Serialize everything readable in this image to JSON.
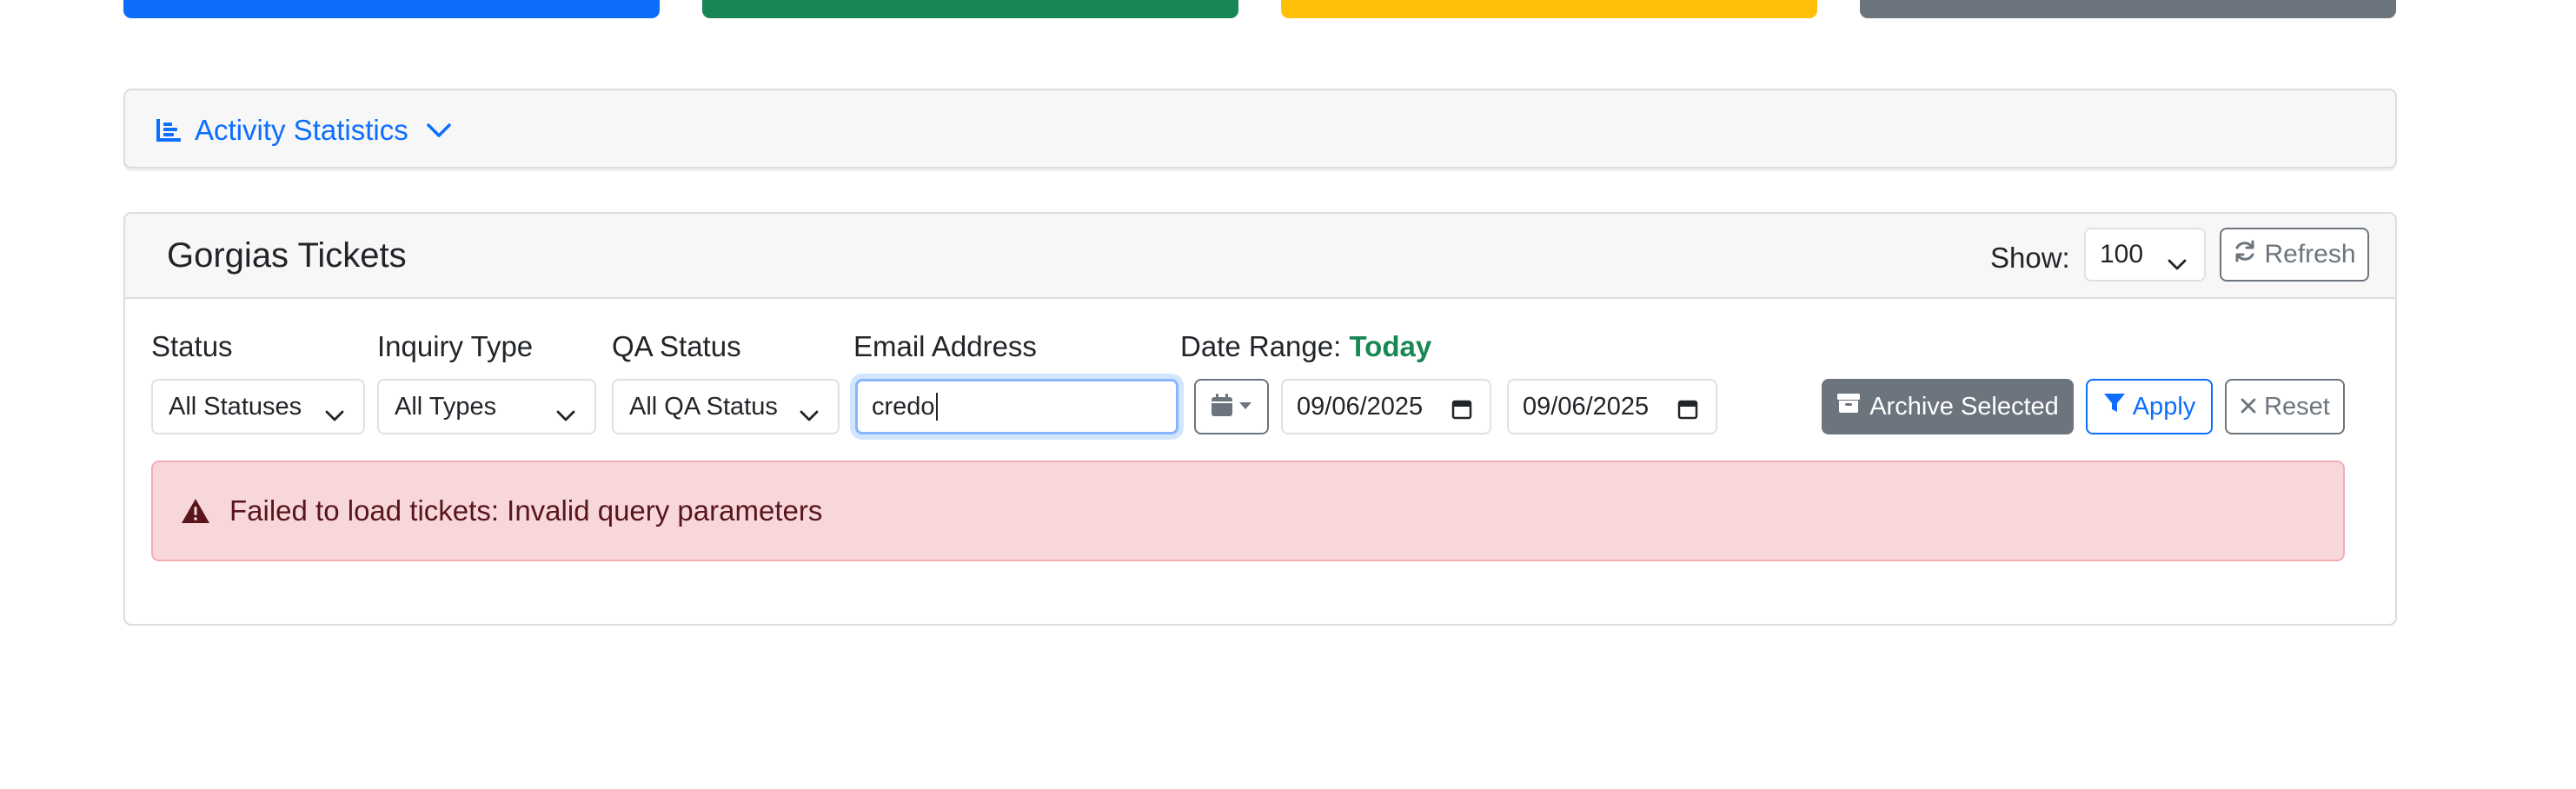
{
  "colors": {
    "primary": "#0d6efd",
    "success": "#198754",
    "warning": "#ffc107",
    "secondary": "#6c757d",
    "danger_bg": "#f8d7da",
    "danger_text": "#58151c"
  },
  "activity": {
    "label": "Activity Statistics",
    "icon": "bar-chart-icon"
  },
  "tickets": {
    "title": "Gorgias Tickets",
    "show_label": "Show:",
    "show_value": "100",
    "refresh_label": "Refresh"
  },
  "filters": {
    "status_label": "Status",
    "status_value": "All Statuses",
    "inquiry_label": "Inquiry Type",
    "inquiry_value": "All Types",
    "qa_label": "QA Status",
    "qa_value": "All QA Status",
    "email_label": "Email Address",
    "email_value": "credo",
    "date_range_label": "Date Range:",
    "date_range_value": "Today",
    "date_from": "09/06/2025",
    "date_to": "09/06/2025"
  },
  "actions": {
    "archive_label": "Archive Selected",
    "apply_label": "Apply",
    "reset_label": "Reset"
  },
  "alert": {
    "message": "Failed to load tickets: Invalid query parameters"
  }
}
